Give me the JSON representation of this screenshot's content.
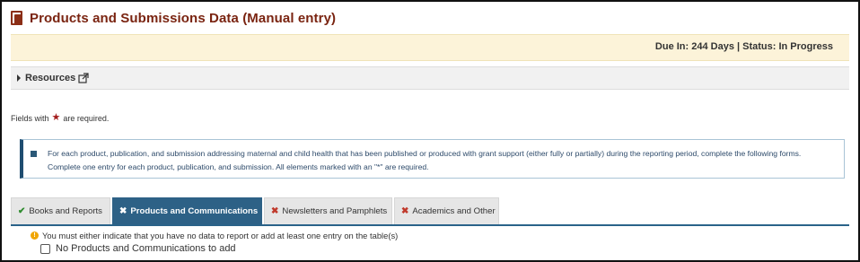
{
  "header": {
    "title": "Products and Submissions Data (Manual entry)",
    "icon": "copy-icon"
  },
  "status": {
    "text": "Due In: 244 Days | Status: In Progress"
  },
  "resources": {
    "label": "Resources",
    "icon": "external-link-icon"
  },
  "required_note": {
    "prefix": "Fields with",
    "suffix": "are required."
  },
  "info": {
    "icon": "info-square-icon",
    "text": "For each product, publication, and submission addressing maternal and child health that has been published or produced with grant support (either fully or partially) during the reporting period, complete the following forms. Complete one entry for each product, publication, and submission. All elements marked with an \"*\" are required."
  },
  "tabs": [
    {
      "label": "Books and Reports",
      "status_icon": "✔",
      "active": false
    },
    {
      "label": "Products and Communications",
      "status_icon": "✖",
      "active": true
    },
    {
      "label": "Newsletters and Pamphlets",
      "status_icon": "✖",
      "active": false
    },
    {
      "label": "Academics and Other",
      "status_icon": "✖",
      "active": false
    }
  ],
  "warning": {
    "text": "You must either indicate that you have no data to report or add at least one entry on the table(s)"
  },
  "no_data_checkbox": {
    "label": "No Products and Communications to add",
    "checked": false
  },
  "colors": {
    "title": "#7a2411",
    "status_bg": "#fcf3d9",
    "active_tab": "#2d6186",
    "check": "#2e8b2e",
    "cross": "#c0392b"
  }
}
